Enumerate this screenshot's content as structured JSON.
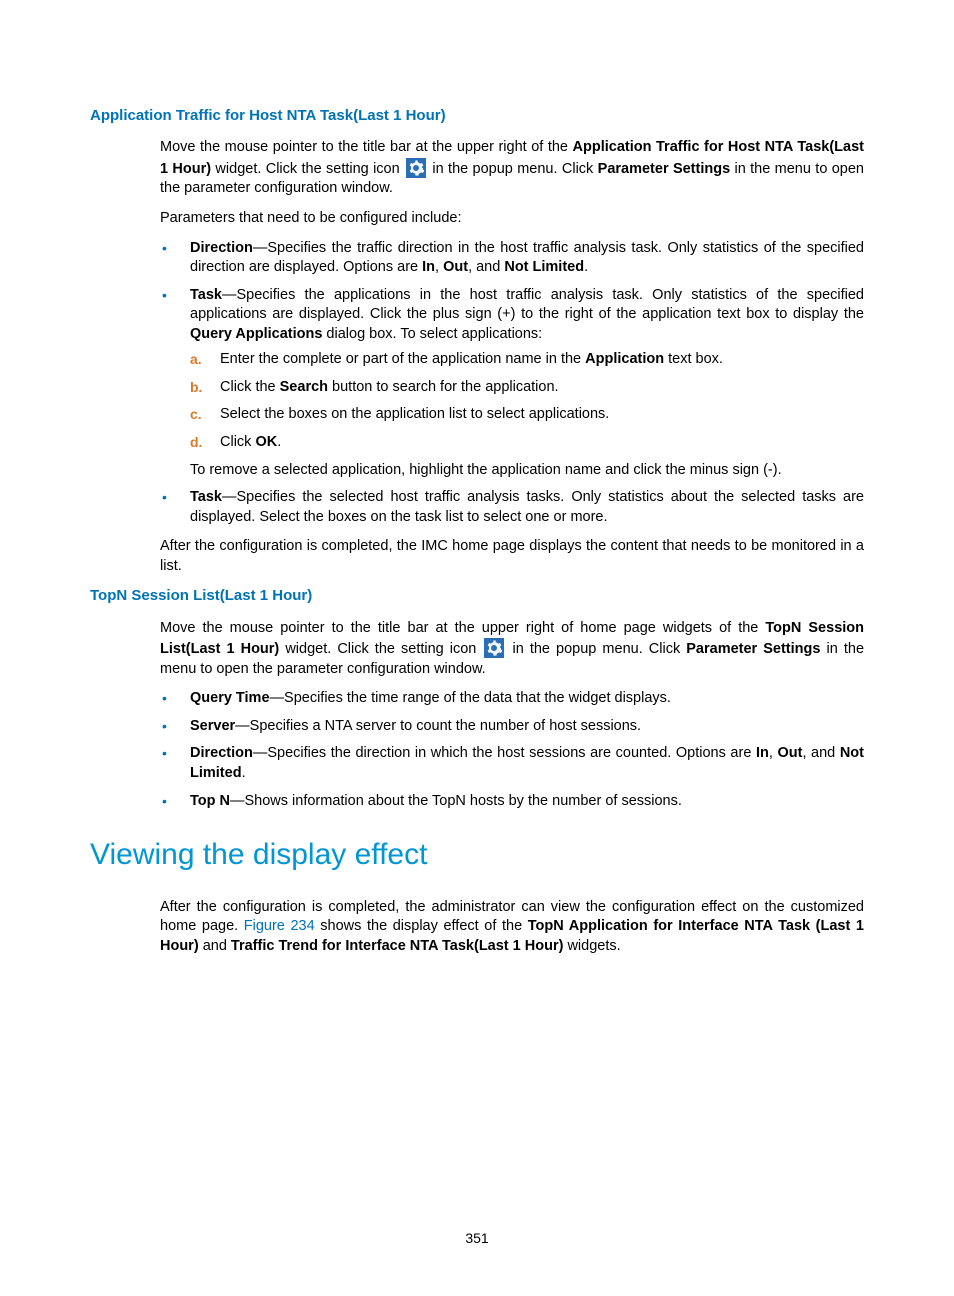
{
  "section1": {
    "heading": "Application Traffic for Host NTA Task(Last 1 Hour)",
    "p1_a": "Move the mouse pointer to the title bar at the upper right of the ",
    "p1_bold1": "Application Traffic for Host NTA Task(Last 1 Hour)",
    "p1_b": " widget. Click the setting icon ",
    "p1_c": " in the popup menu. Click ",
    "p1_bold2": "Parameter Settings",
    "p1_d": " in the menu to open the parameter configuration window.",
    "p2": "Parameters that need to be configured include:",
    "bullets": {
      "b1_label": "Direction",
      "b1_a": "—Specifies the traffic direction in the host traffic analysis task. Only statistics of the specified direction are displayed. Options are ",
      "b1_in": "In",
      "b1_sep1": ", ",
      "b1_out": "Out",
      "b1_sep2": ", and ",
      "b1_nl": "Not Limited",
      "b1_end": ".",
      "b2_label": "Task",
      "b2_a": "—Specifies the applications in the host traffic analysis task. Only statistics of the specified applications are displayed. Click the plus sign (+) to the right of the application text box to display the ",
      "b2_bold": "Query Applications",
      "b2_b": " dialog box. To select applications:",
      "steps": {
        "a_text_a": "Enter the complete or part of the application name in the ",
        "a_bold": "Application",
        "a_text_b": " text box.",
        "b_text_a": "Click the ",
        "b_bold": "Search",
        "b_text_b": " button to search for the application.",
        "c_text": "Select the boxes on the application list to select applications.",
        "d_text_a": "Click ",
        "d_bold": "OK",
        "d_text_b": "."
      },
      "b2_after": "To remove a selected application, highlight the application name and click the minus sign (-).",
      "b3_label": "Task",
      "b3_a": "—Specifies the selected host traffic analysis tasks. Only statistics about the selected tasks are displayed. Select the boxes on the task list to select one or more."
    },
    "p3": "After the configuration is completed, the IMC home page displays the content that needs to be monitored in a list."
  },
  "section2": {
    "heading": "TopN Session List(Last 1 Hour)",
    "p1_a": "Move the mouse pointer to the title bar at the upper right of home page widgets of the ",
    "p1_bold1": "TopN Session List(Last 1 Hour)",
    "p1_b": " widget. Click the setting icon ",
    "p1_c": " in the popup menu. Click ",
    "p1_bold2": "Parameter Settings",
    "p1_d": " in the menu to open the parameter configuration window.",
    "bullets": {
      "b1_label": "Query Time",
      "b1_text": "—Specifies the time range of the data that the widget displays.",
      "b2_label": "Server",
      "b2_text": "—Specifies a NTA server to count the number of host sessions.",
      "b3_label": "Direction",
      "b3_a": "—Specifies the direction in which the host sessions are counted. Options are ",
      "b3_in": "In",
      "b3_sep1": ", ",
      "b3_out": "Out",
      "b3_sep2": ", and ",
      "b3_nl": "Not Limited",
      "b3_end": ".",
      "b4_label": "Top N",
      "b4_text": "—Shows information about the TopN hosts by the number of sessions."
    }
  },
  "section3": {
    "heading": "Viewing the display effect",
    "p1_a": "After the configuration is completed, the administrator can view the configuration effect on the customized home page. ",
    "p1_link": "Figure 234",
    "p1_b": " shows the display effect of the ",
    "p1_bold1": "TopN Application for Interface NTA Task (Last 1 Hour)",
    "p1_c": " and ",
    "p1_bold2": "Traffic Trend for Interface NTA Task(Last 1 Hour)",
    "p1_d": " widgets."
  },
  "page_number": "351",
  "letters": {
    "a": "a.",
    "b": "b.",
    "c": "c.",
    "d": "d."
  }
}
